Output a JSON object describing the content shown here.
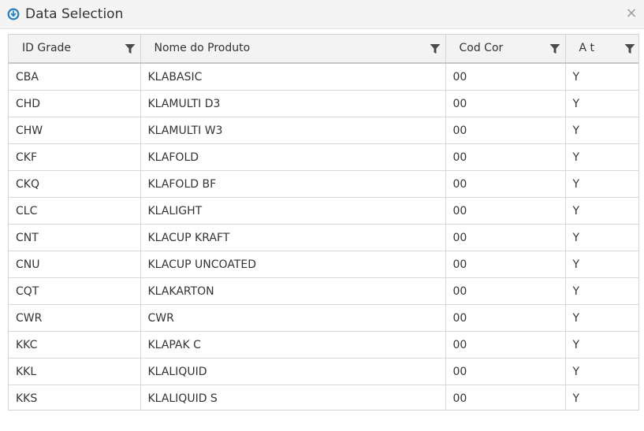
{
  "window": {
    "title": "Data Selection",
    "close_label": "×"
  },
  "grid": {
    "columns": [
      {
        "label": "ID Grade",
        "icon": "filter-icon"
      },
      {
        "label": "Nome do Produto",
        "icon": "filter-icon"
      },
      {
        "label": "Cod Cor",
        "icon": "filter-icon"
      },
      {
        "label": "A t",
        "icon": "filter-icon"
      }
    ],
    "rows": [
      [
        "CBA",
        "KLABASIC",
        "00",
        "Y"
      ],
      [
        "CHD",
        "KLAMULTI D3",
        "00",
        "Y"
      ],
      [
        "CHW",
        "KLAMULTI W3",
        "00",
        "Y"
      ],
      [
        "CKF",
        "KLAFOLD",
        "00",
        "Y"
      ],
      [
        "CKQ",
        "KLAFOLD BF",
        "00",
        "Y"
      ],
      [
        "CLC",
        "KLALIGHT",
        "00",
        "Y"
      ],
      [
        "CNT",
        "KLACUP KRAFT",
        "00",
        "Y"
      ],
      [
        "CNU",
        "KLACUP UNCOATED",
        "00",
        "Y"
      ],
      [
        "CQT",
        "KLAKARTON",
        "00",
        "Y"
      ],
      [
        "CWR",
        "CWR",
        "00",
        "Y"
      ],
      [
        "KKC",
        "KLAPAK C",
        "00",
        "Y"
      ],
      [
        "KKL",
        "KLALIQUID",
        "00",
        "Y"
      ],
      [
        "KKS",
        "KLALIQUID S",
        "00",
        "Y"
      ]
    ]
  },
  "colors": {
    "accent": "#2a7fc1",
    "filter_icon": "#4a4a4a",
    "header_bg": "#f3f3f3"
  }
}
